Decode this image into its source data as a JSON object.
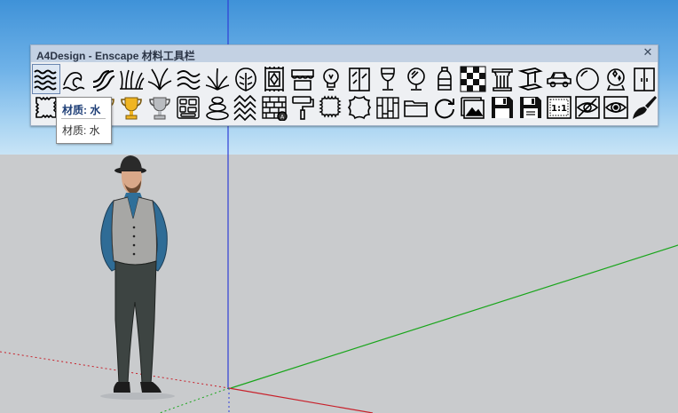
{
  "toolbar": {
    "title": "A4Design - Enscape 材料工具栏",
    "close_glyph": "✕",
    "row1": [
      {
        "name": "water-waves-icon"
      },
      {
        "name": "ocean-wave-icon"
      },
      {
        "name": "water-ripple-icon"
      },
      {
        "name": "grass-icon"
      },
      {
        "name": "reed-grass-icon"
      },
      {
        "name": "wheat-grass-icon"
      },
      {
        "name": "shrub-icon"
      },
      {
        "name": "monstera-leaf-icon"
      },
      {
        "name": "carpet-icon"
      },
      {
        "name": "awning-icon"
      },
      {
        "name": "light-bulb-icon"
      },
      {
        "name": "window-glass-icon"
      },
      {
        "name": "wine-glass-icon"
      },
      {
        "name": "mirror-icon"
      },
      {
        "name": "bottle-icon"
      },
      {
        "name": "checker-tile-icon"
      },
      {
        "name": "column-icon"
      },
      {
        "name": "steel-beam-icon"
      },
      {
        "name": "car-icon"
      },
      {
        "name": "sphere-icon"
      },
      {
        "name": "crystal-ball-icon"
      },
      {
        "name": "door-panel-icon"
      }
    ],
    "row2": [
      {
        "name": "fabric-swatch-icon"
      },
      {
        "name": "pattern-grid-icon"
      },
      {
        "name": "gold-trophy-icon"
      },
      {
        "name": "gold-cup-icon"
      },
      {
        "name": "silver-trophy-icon"
      },
      {
        "name": "paving-stones-icon"
      },
      {
        "name": "stacked-stones-icon"
      },
      {
        "name": "herringbone-icon"
      },
      {
        "name": "brick-wall-icon"
      },
      {
        "name": "paint-roller-icon"
      },
      {
        "name": "stamp-icon"
      },
      {
        "name": "leather-hide-icon"
      },
      {
        "name": "wood-planks-icon"
      },
      {
        "name": "folder-icon"
      },
      {
        "name": "refresh-icon"
      },
      {
        "name": "image-icon"
      },
      {
        "name": "save-icon"
      },
      {
        "name": "save-as-icon"
      },
      {
        "name": "scale-1to1-icon",
        "text": "1:1"
      },
      {
        "name": "hide-icon"
      },
      {
        "name": "view-icon"
      },
      {
        "name": "paint-brush-icon"
      }
    ]
  },
  "tooltip": {
    "heading": "材质: 水",
    "body": "材质: 水"
  },
  "colors": {
    "sky_top": "#3f92d8",
    "ground": "#c9cbcd",
    "axis_blue": "#2f3fd6",
    "axis_green": "#18a51a",
    "axis_red": "#c8202a",
    "gold": "#e0a419"
  }
}
